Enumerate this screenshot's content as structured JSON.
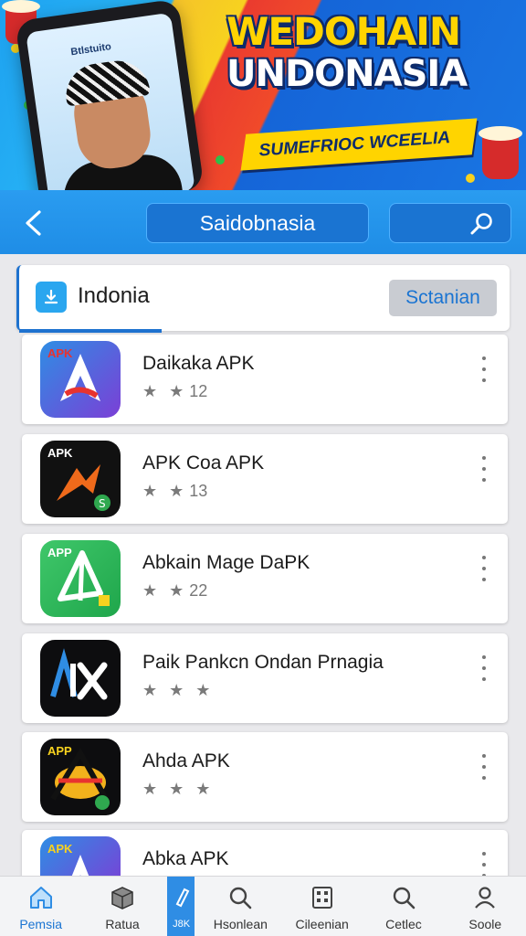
{
  "banner": {
    "headline_line1": "WEDOHAIN",
    "headline_line2": "UNDONASIA",
    "subheadline": "SUMEFRIOC WCEELIA",
    "phone_screen_label": "Btlstuito"
  },
  "toolbar": {
    "search_text": "Saidobnasia",
    "back_icon": "chevron-left-icon",
    "action_icon": "search-icon"
  },
  "filter": {
    "label": "Indonia",
    "button_label": "Sctanian",
    "icon": "download-icon"
  },
  "apps": [
    {
      "name": "Daikaka APK",
      "stars": "★ ★",
      "count": "12",
      "icon_tag": "APK"
    },
    {
      "name": "APK Coa APK",
      "stars": "★ ★",
      "count": "13",
      "icon_tag": "APK"
    },
    {
      "name": "Abkain Mage DaPK",
      "stars": "★ ★",
      "count": "22",
      "icon_tag": "APP"
    },
    {
      "name": "Paik Pankcn Ondan Prnagia",
      "stars": "★ ★ ★",
      "count": "",
      "icon_tag": ""
    },
    {
      "name": "Ahda APK",
      "stars": "★ ★ ★",
      "count": "",
      "icon_tag": "APP"
    },
    {
      "name": "Abka APK",
      "stars": "",
      "count": "",
      "icon_tag": "APK"
    }
  ],
  "bottom_nav": [
    {
      "label": "Pemsia",
      "icon": "home-icon"
    },
    {
      "label": "Ratua",
      "icon": "box-icon"
    },
    {
      "label": "J8K",
      "icon": "pen-icon"
    },
    {
      "label": "Hsonlean",
      "icon": "search-icon"
    },
    {
      "label": "Cileenian",
      "icon": "calculator-icon"
    },
    {
      "label": "Cetlec",
      "icon": "search-icon"
    },
    {
      "label": "Soole",
      "icon": "user-icon"
    }
  ],
  "colors": {
    "accent": "#1f8de6",
    "accent_dark": "#1a74d2",
    "page_bg": "#e9e9ec"
  }
}
